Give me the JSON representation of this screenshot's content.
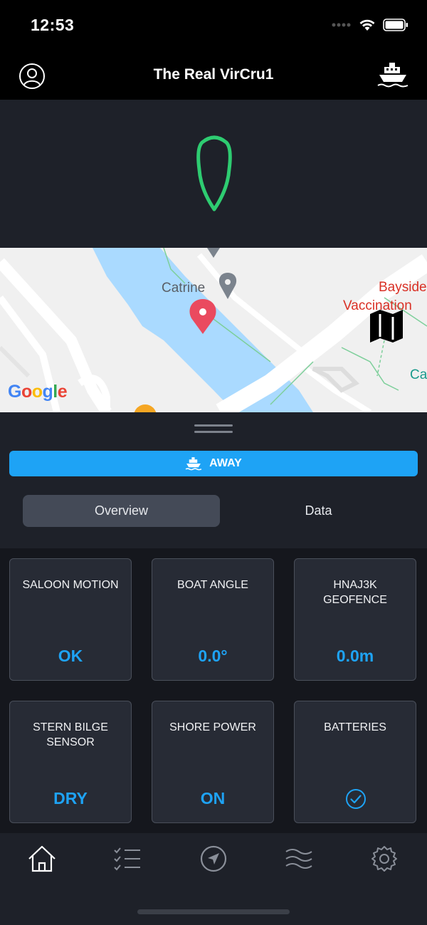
{
  "status_bar": {
    "time": "12:53"
  },
  "header": {
    "title": "The Real VirCru1",
    "left_icon": "profile-icon",
    "right_icon": "boat-icon"
  },
  "colors": {
    "accent": "#1ea3f5",
    "heading_marker": "#2ecc71",
    "map_water": "#aadaff",
    "map_pin": "#ea4a5f"
  },
  "map": {
    "labels": {
      "catrine": "Catrine",
      "bayside": "Bayside",
      "vaccination": "Vaccination",
      "partial_label": "Ca"
    },
    "logo": [
      "G",
      "o",
      "o",
      "g",
      "l",
      "e"
    ],
    "logo_colors": [
      "#4285f4",
      "#ea4335",
      "#fbbc05",
      "#4285f4",
      "#34a853",
      "#ea4335"
    ],
    "toggle_icon": "map-icon"
  },
  "status_button": {
    "label": "AWAY",
    "icon": "boat-icon"
  },
  "segments": {
    "overview": "Overview",
    "data": "Data",
    "selected": "Overview"
  },
  "tiles": [
    {
      "title": "SALOON MOTION",
      "value": "OK"
    },
    {
      "title": "BOAT ANGLE",
      "value": "0.0°"
    },
    {
      "title": "HNAJ3K GEOFENCE",
      "value": "0.0m"
    },
    {
      "title": "STERN BILGE SENSOR",
      "value": "DRY"
    },
    {
      "title": "SHORE POWER",
      "value": "ON"
    },
    {
      "title": "BATTERIES",
      "value": "",
      "icon": "check-circle-icon"
    }
  ],
  "tabbar": {
    "icons": [
      "home-icon",
      "checklist-icon",
      "navigation-icon",
      "waves-icon",
      "gear-icon"
    ],
    "selected": "home-icon"
  }
}
